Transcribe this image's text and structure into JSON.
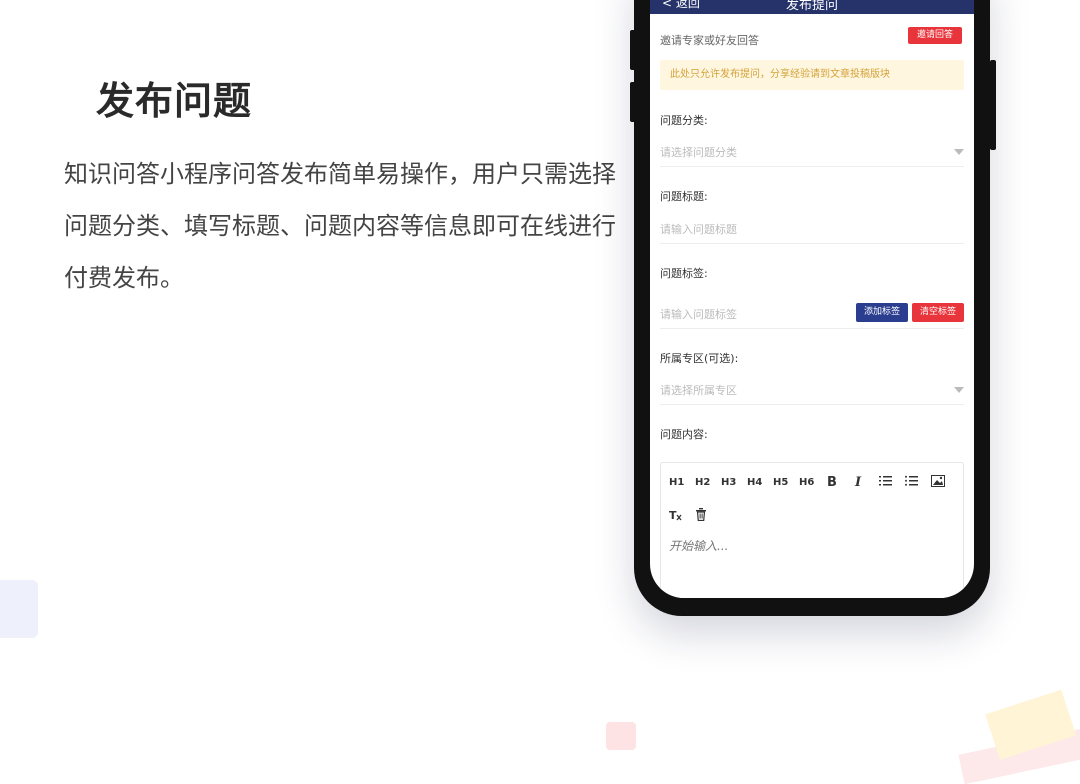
{
  "hero": {
    "title": "发布问题",
    "description": "知识问答小程序问答发布简单易操作，用户只需选择问题分类、填写标题、问题内容等信息即可在线进行付费发布。"
  },
  "app": {
    "back_label": "< 返回",
    "title": "发布提问",
    "invite_label": "邀请专家或好友回答",
    "invite_button": "邀请回答",
    "notice": "此处只允许发布提问，分享经验请到文章投稿版块",
    "category_label": "问题分类:",
    "category_placeholder": "请选择问题分类",
    "title_label": "问题标题:",
    "title_placeholder": "请输入问题标题",
    "tags_label": "问题标签:",
    "tags_placeholder": "请输入问题标签",
    "add_tag_button": "添加标签",
    "clear_tags_button": "清空标签",
    "zone_label": "所属专区(可选):",
    "zone_placeholder": "请选择所属专区",
    "content_label": "问题内容:",
    "editor_tools": [
      "H1",
      "H2",
      "H3",
      "H4",
      "H5",
      "H6",
      "B",
      "I"
    ],
    "editor_placeholder": "开始输入..."
  },
  "colors": {
    "navy": "#26336b",
    "red": "#e8353b",
    "notice_bg": "#fff6df",
    "notice_text": "#d4a23a"
  }
}
